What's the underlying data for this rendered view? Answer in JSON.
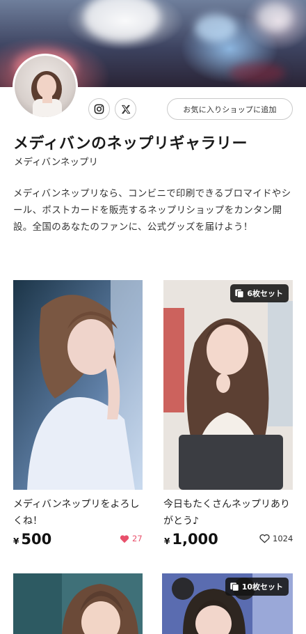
{
  "shop": {
    "title": "メディバンのネップリギャラリー",
    "subtitle": "メディバンネップリ",
    "description": "メディバンネップリなら、コンビニで印刷できるブロマイドやシール、ポストカードを販売するネップリショップをカンタン開設。全国のあなたのファンに、公式グッズを届けよう！",
    "favorite_button_label": "お気に入りショップに追加",
    "social": [
      "instagram-icon",
      "x-icon"
    ]
  },
  "products": [
    {
      "title": "メディバンネップリをよろしくね！",
      "currency": "¥",
      "price": "500",
      "likes": "27",
      "liked": true,
      "badge": ""
    },
    {
      "title": "今日もたくさんネップリありがとう♪",
      "currency": "¥",
      "price": "1,000",
      "likes": "1024",
      "liked": false,
      "badge": "6枚セット"
    },
    {
      "title": "",
      "badge": ""
    },
    {
      "title": "",
      "badge": "10枚セット"
    }
  ],
  "colors": {
    "liked": "#e8506b",
    "badge_bg": "#1a1a1a",
    "text": "#1a1a1a",
    "border": "#c9c9c9"
  }
}
